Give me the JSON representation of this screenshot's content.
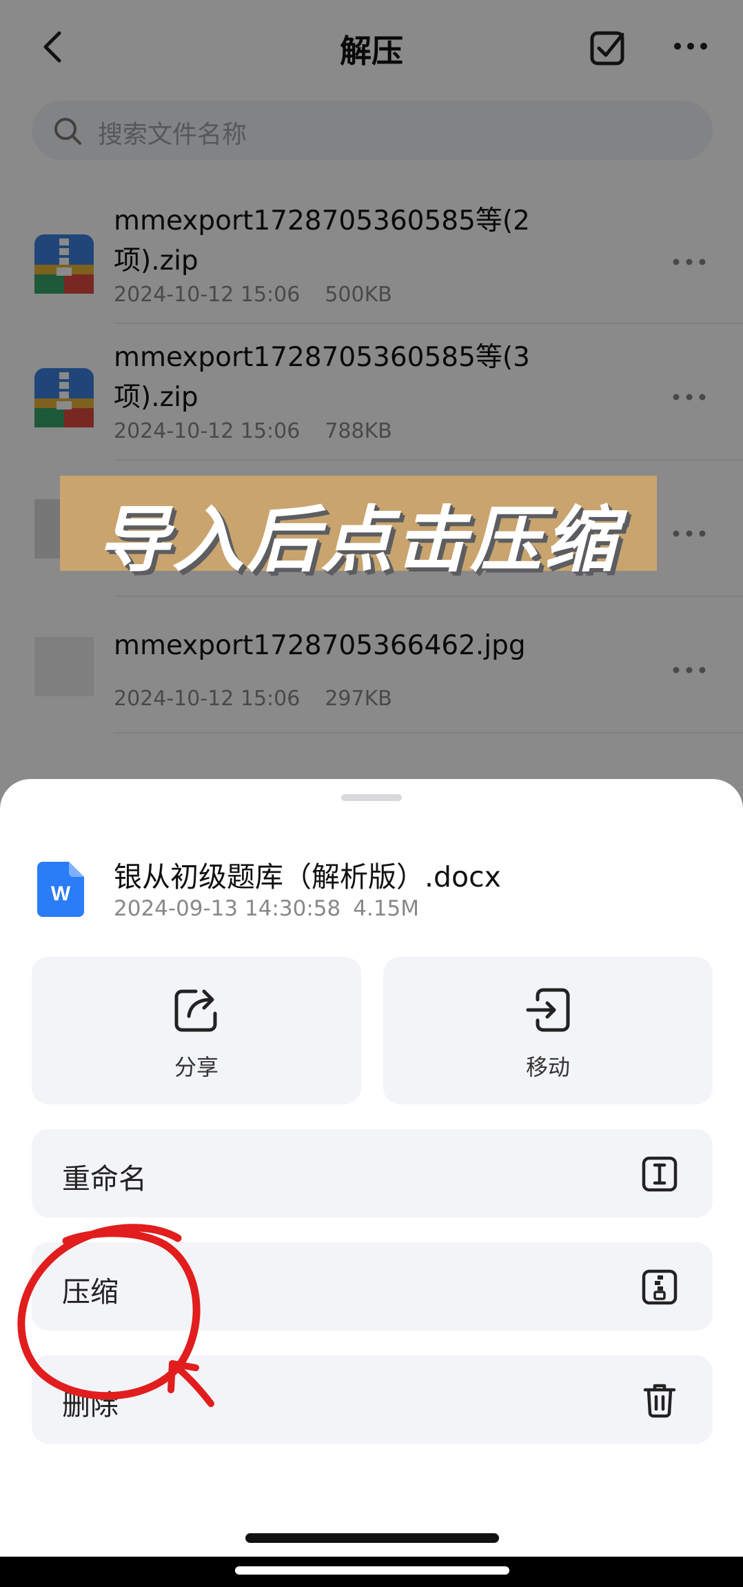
{
  "header": {
    "title": "解压"
  },
  "search": {
    "placeholder": "搜索文件名称"
  },
  "files": [
    {
      "name": "mmexport1728705360585等(2项).zip",
      "date": "2024-10-12 15:06",
      "size": "500KB"
    },
    {
      "name": "mmexport1728705360585等(3项).zip",
      "date": "2024-10-12 15:06",
      "size": "788KB"
    },
    {
      "name": "mmexport1728705366462.jpg",
      "date": "2024-10-12 15:06",
      "size": "297KB"
    }
  ],
  "banner": {
    "text": "导入后点击压缩"
  },
  "sheet": {
    "file_name": "银从初级题库（解析版）.docx",
    "file_date": "2024-09-13 14:30:58",
    "file_size": "4.15M",
    "share_label": "分享",
    "move_label": "移动",
    "options": [
      {
        "label": "重命名",
        "icon": "rename-icon"
      },
      {
        "label": "压缩",
        "icon": "compress-icon"
      },
      {
        "label": "删除",
        "icon": "trash-icon"
      }
    ]
  },
  "colors": {
    "annotation": "#e11d1d",
    "banner": "#c9a46e",
    "word_blue": "#2b7cf7"
  }
}
